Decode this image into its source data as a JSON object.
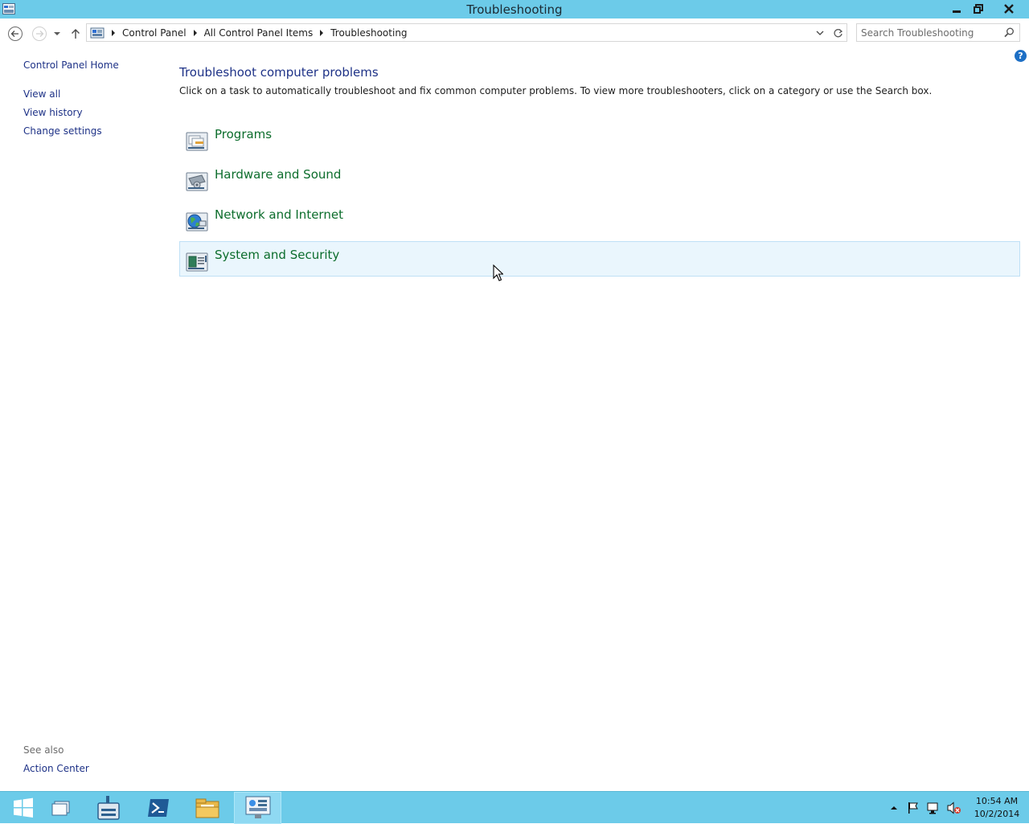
{
  "window": {
    "title": "Troubleshooting"
  },
  "address": {
    "crumbs": [
      "Control Panel",
      "All Control Panel Items",
      "Troubleshooting"
    ]
  },
  "search": {
    "placeholder": "Search Troubleshooting"
  },
  "sidebar": {
    "home": "Control Panel Home",
    "items": [
      "View all",
      "View history",
      "Change settings"
    ]
  },
  "main": {
    "title": "Troubleshoot computer problems",
    "description": "Click on a task to automatically troubleshoot and fix common computer problems. To view more troubleshooters, click on a category or use the Search box.",
    "categories": [
      {
        "label": "Programs",
        "icon": "programs-icon"
      },
      {
        "label": "Hardware and Sound",
        "icon": "hardware-sound-icon"
      },
      {
        "label": "Network and Internet",
        "icon": "network-internet-icon"
      },
      {
        "label": "System and Security",
        "icon": "system-security-icon"
      }
    ],
    "hovered_category_index": 3
  },
  "see_also": {
    "heading": "See also",
    "links": [
      "Action Center"
    ]
  },
  "taskbar": {
    "clock_time": "10:54 AM",
    "clock_date": "10/2/2014"
  },
  "colors": {
    "titlebar": "#6ccbe9",
    "link_blue": "#1e3287",
    "category_green": "#0c6d2c",
    "hover_bg": "#eaf6fd"
  }
}
